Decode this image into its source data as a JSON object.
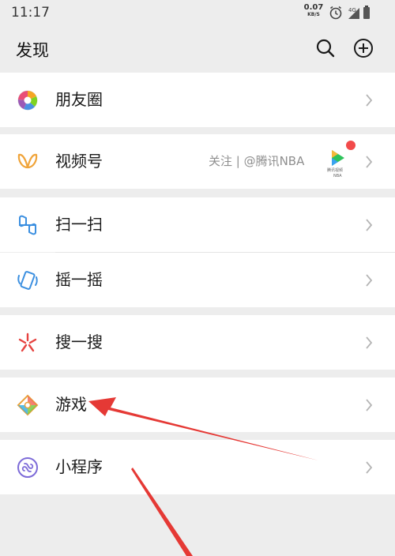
{
  "status_bar": {
    "time": "11:17",
    "net_speed": "0.07",
    "net_speed_unit": "KB/S",
    "signal_label": "4G",
    "icons": [
      "alarm-clock-icon",
      "signal-icon",
      "battery-icon"
    ]
  },
  "header": {
    "title": "发现",
    "actions": [
      "search-icon",
      "add-circle-icon"
    ]
  },
  "menu": {
    "moments": {
      "label": "朋友圈",
      "icon": "moments-aperture-icon"
    },
    "channels": {
      "label": "视频号",
      "subtext": "关注 | @腾讯NBA",
      "icon": "channels-butterfly-icon",
      "thumbnail_text": "腾讯视频",
      "thumbnail_subtext": "NBA",
      "badge": "red-dot"
    },
    "scan": {
      "label": "扫一扫",
      "icon": "scan-icon"
    },
    "shake": {
      "label": "摇一摇",
      "icon": "shake-phone-icon"
    },
    "search": {
      "label": "搜一搜",
      "icon": "search-star-icon"
    },
    "games": {
      "label": "游戏",
      "icon": "games-diamond-icon"
    },
    "mini_programs": {
      "label": "小程序",
      "icon": "mini-program-icon"
    }
  },
  "colors": {
    "background": "#ededed",
    "row": "#ffffff",
    "annotation_arrow": "#e53935",
    "badge": "#f24a4a",
    "subtext": "#8f8f8f"
  }
}
